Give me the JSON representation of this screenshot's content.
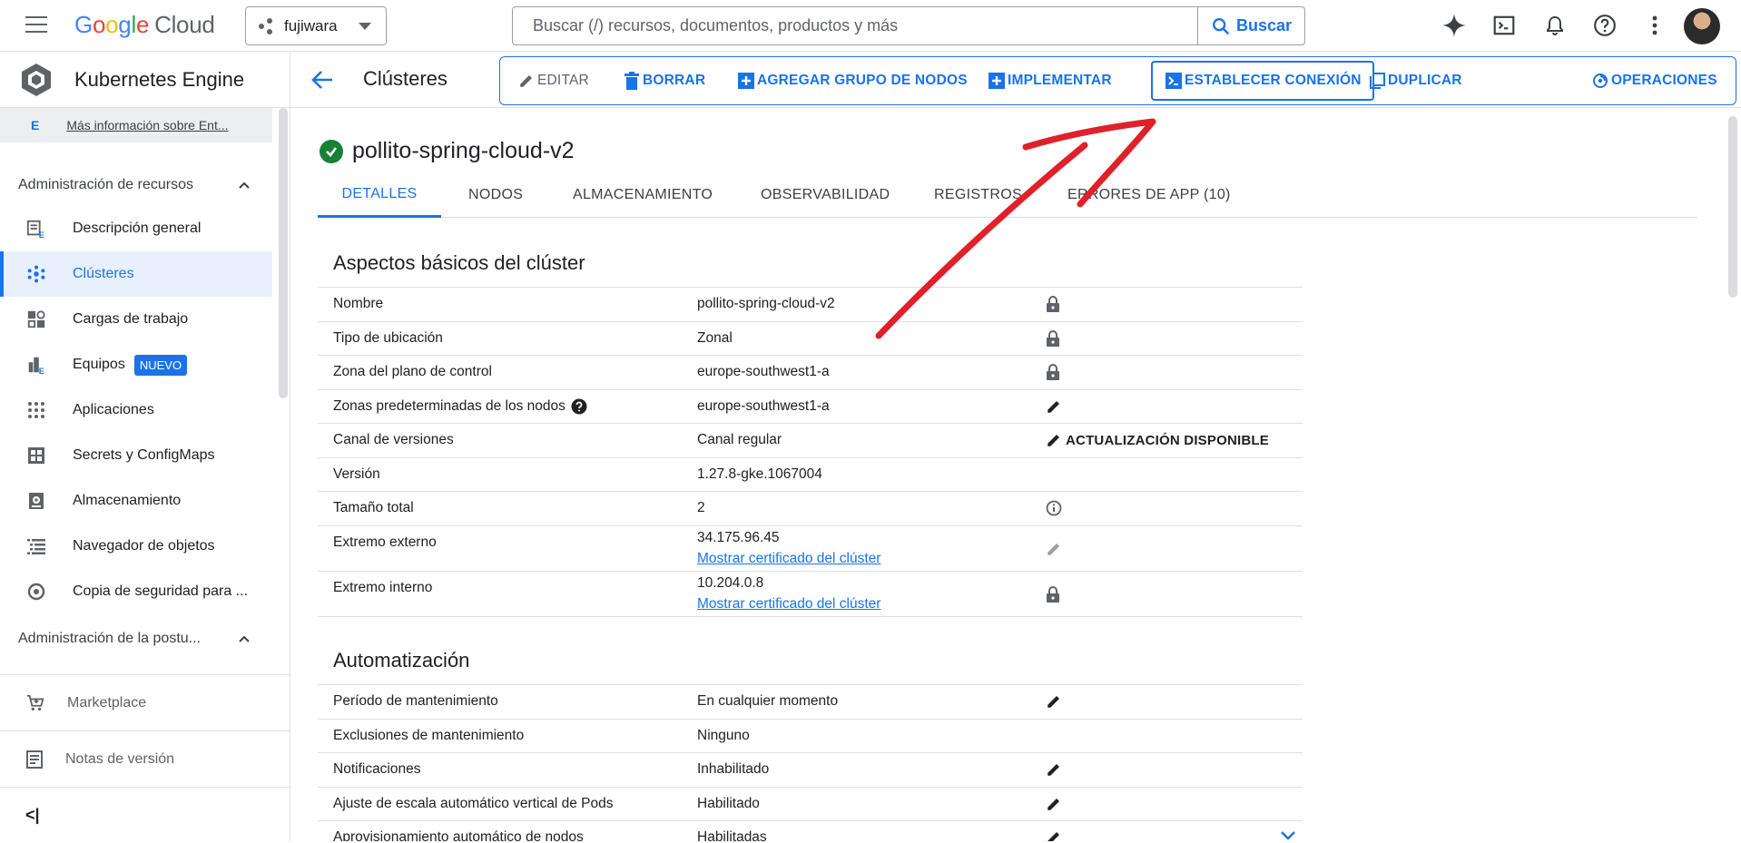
{
  "topbar": {
    "logo_google": [
      "G",
      "o",
      "o",
      "g",
      "l",
      "e"
    ],
    "logo_cloud": "Cloud",
    "project": "fujiwara",
    "search_placeholder": "Buscar (/) recursos, documentos, productos y más",
    "search_button": "Buscar"
  },
  "sidebar": {
    "product_title": "Kubernetes Engine",
    "info_badge": "E",
    "info_link": "Más información sobre Ent...",
    "section_resources": "Administración de recursos",
    "items": [
      {
        "label": "Descripción general",
        "icon": "overview-icon"
      },
      {
        "label": "Clústeres",
        "icon": "clusters-icon"
      },
      {
        "label": "Cargas de trabajo",
        "icon": "workloads-icon"
      },
      {
        "label": "Equipos",
        "icon": "teams-icon",
        "badge": "NUEVO"
      },
      {
        "label": "Aplicaciones",
        "icon": "apps-grid-icon"
      },
      {
        "label": "Secrets y ConfigMaps",
        "icon": "secrets-icon"
      },
      {
        "label": "Almacenamiento",
        "icon": "storage-icon"
      },
      {
        "label": "Navegador de objetos",
        "icon": "object-browser-icon"
      },
      {
        "label": "Copia de seguridad para ...",
        "icon": "backup-icon"
      }
    ],
    "section_posture": "Administración de la postu...",
    "marketplace": "Marketplace",
    "release_notes": "Notas de versión",
    "collapse_label": "<|"
  },
  "header": {
    "page_title": "Clústeres",
    "actions": {
      "edit": "EDITAR",
      "delete": "BORRAR",
      "add_node_pool": "AGREGAR GRUPO DE NODOS",
      "deploy": "IMPLEMENTAR",
      "connect": "ESTABLECER CONEXIÓN",
      "duplicate": "DUPLICAR",
      "operations": "OPERACIONES"
    }
  },
  "cluster": {
    "name": "pollito-spring-cloud-v2",
    "tabs": [
      "DETALLES",
      "NODOS",
      "ALMACENAMIENTO",
      "OBSERVABILIDAD",
      "REGISTROS",
      "ERRORES DE APP (10)"
    ],
    "basics_title": "Aspectos básicos del clúster",
    "basics": [
      {
        "key": "Nombre",
        "value": "pollito-spring-cloud-v2",
        "icon": "lock-icon"
      },
      {
        "key": "Tipo de ubicación",
        "value": "Zonal",
        "icon": "lock-icon"
      },
      {
        "key": "Zona del plano de control",
        "value": "europe-southwest1-a",
        "icon": "lock-icon"
      },
      {
        "key": "Zonas predeterminadas de los nodos",
        "value": "europe-southwest1-a",
        "icon": "edit-icon"
      },
      {
        "key": "Canal de versiones",
        "value": "Canal regular",
        "icon": "edit-icon",
        "action": "ACTUALIZACIÓN DISPONIBLE"
      },
      {
        "key": "Versión",
        "value": "1.27.8-gke.1067004"
      },
      {
        "key": "Tamaño total",
        "value": "2",
        "icon": "info-icon"
      },
      {
        "key": "Extremo externo",
        "value": "34.175.96.45",
        "link": "Mostrar certificado del clúster",
        "icon": "edit-icon-disabled"
      },
      {
        "key": "Extremo interno",
        "value": "10.204.0.8",
        "link": "Mostrar certificado del clúster",
        "icon": "lock-icon"
      }
    ],
    "automation_title": "Automatización",
    "automation": [
      {
        "key": "Período de mantenimiento",
        "value": "En cualquier momento",
        "icon": "edit-icon"
      },
      {
        "key": "Exclusiones de mantenimiento",
        "value": "Ninguno"
      },
      {
        "key": "Notificaciones",
        "value": "Inhabilitado",
        "icon": "edit-icon"
      },
      {
        "key": "Ajuste de escala automático vertical de Pods",
        "value": "Habilitado",
        "icon": "edit-icon"
      },
      {
        "key": "Aprovisionamiento automático de nodos",
        "value": "Habilitadas",
        "icon": "edit-icon"
      }
    ]
  },
  "colors": {
    "accent": "#1a73e8",
    "success": "#188038",
    "annotation": "#e0202a"
  }
}
